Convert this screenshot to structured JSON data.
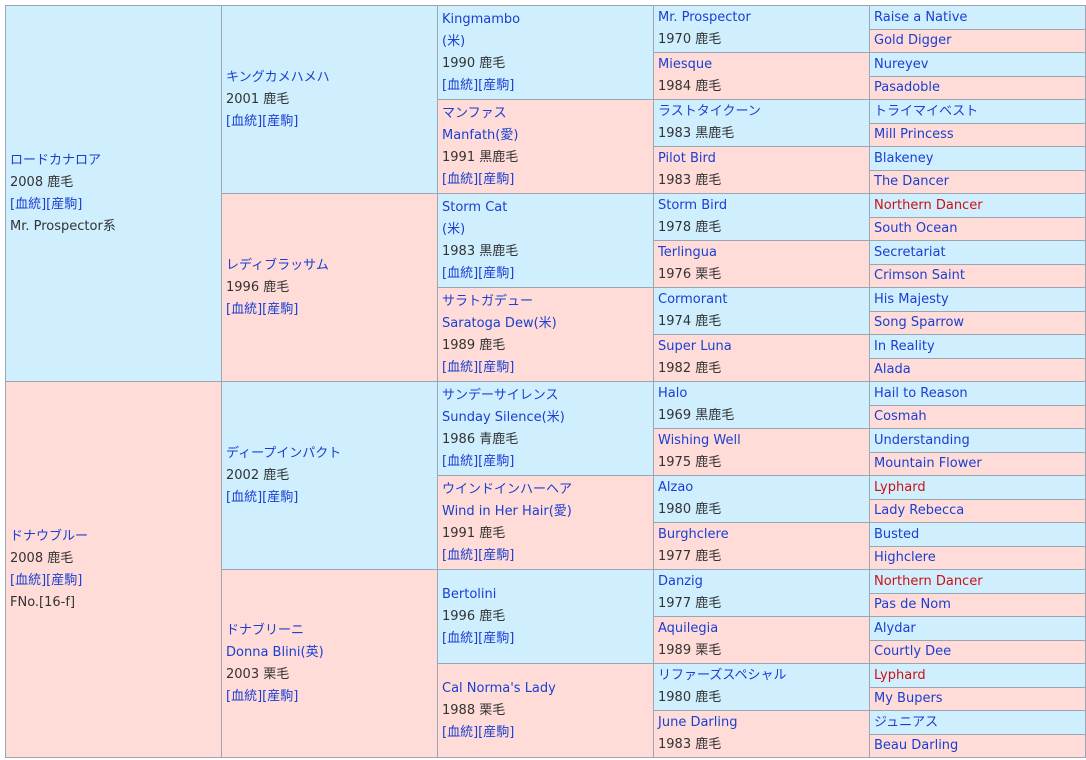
{
  "link_color": "#1a3fd1",
  "highlight_color": "#d01010",
  "male_bg": "#cfefff",
  "female_bg": "#ffdcd8",
  "cells": [
    {
      "id": "g0-0",
      "gen": 0,
      "row": 0,
      "span": 16,
      "sex": "m",
      "lines": [
        {
          "t": "ロードカナロア",
          "link": true
        },
        {
          "t": "2008 鹿毛"
        },
        {
          "t": "[血統][産駒]",
          "link": true
        },
        {
          "t": "Mr. Prospector系"
        }
      ]
    },
    {
      "id": "g0-1",
      "gen": 0,
      "row": 16,
      "span": 16,
      "sex": "f",
      "lines": [
        {
          "t": "ドナウブルー",
          "link": true
        },
        {
          "t": "2008 鹿毛"
        },
        {
          "t": "[血統][産駒]",
          "link": true
        },
        {
          "t": "FNo.[16-f]"
        }
      ]
    },
    {
      "id": "g1-0",
      "gen": 1,
      "row": 0,
      "span": 8,
      "sex": "m",
      "lines": [
        {
          "t": "キングカメハメハ",
          "link": true
        },
        {
          "t": "2001 鹿毛"
        },
        {
          "t": "[血統][産駒]",
          "link": true
        }
      ]
    },
    {
      "id": "g1-1",
      "gen": 1,
      "row": 8,
      "span": 8,
      "sex": "f",
      "lines": [
        {
          "t": "レディブラッサム",
          "link": true
        },
        {
          "t": "1996 鹿毛"
        },
        {
          "t": "[血統][産駒]",
          "link": true
        }
      ]
    },
    {
      "id": "g1-2",
      "gen": 1,
      "row": 16,
      "span": 8,
      "sex": "m",
      "lines": [
        {
          "t": "ディープインパクト",
          "link": true
        },
        {
          "t": "2002 鹿毛"
        },
        {
          "t": "[血統][産駒]",
          "link": true
        }
      ]
    },
    {
      "id": "g1-3",
      "gen": 1,
      "row": 24,
      "span": 8,
      "sex": "f",
      "lines": [
        {
          "t": "ドナブリーニ",
          "link": true
        },
        {
          "t": "Donna Blini(英)",
          "link": true
        },
        {
          "t": "2003 栗毛"
        },
        {
          "t": "[血統][産駒]",
          "link": true
        }
      ]
    },
    {
      "id": "g2-0",
      "gen": 2,
      "row": 0,
      "span": 4,
      "sex": "m",
      "lines": [
        {
          "t": "Kingmambo",
          "link": true
        },
        {
          "t": "(米)",
          "link": true
        },
        {
          "t": "1990 鹿毛"
        },
        {
          "t": "[血統][産駒]",
          "link": true
        }
      ]
    },
    {
      "id": "g2-1",
      "gen": 2,
      "row": 4,
      "span": 4,
      "sex": "f",
      "lines": [
        {
          "t": "マンファス",
          "link": true
        },
        {
          "t": "Manfath(愛)",
          "link": true
        },
        {
          "t": "1991 黒鹿毛"
        },
        {
          "t": "[血統][産駒]",
          "link": true
        }
      ]
    },
    {
      "id": "g2-2",
      "gen": 2,
      "row": 8,
      "span": 4,
      "sex": "m",
      "lines": [
        {
          "t": "Storm Cat",
          "link": true
        },
        {
          "t": "(米)",
          "link": true
        },
        {
          "t": "1983 黒鹿毛"
        },
        {
          "t": "[血統][産駒]",
          "link": true
        }
      ]
    },
    {
      "id": "g2-3",
      "gen": 2,
      "row": 12,
      "span": 4,
      "sex": "f",
      "lines": [
        {
          "t": "サラトガデュー",
          "link": true
        },
        {
          "t": "Saratoga Dew(米)",
          "link": true
        },
        {
          "t": "1989 鹿毛"
        },
        {
          "t": "[血統][産駒]",
          "link": true
        }
      ]
    },
    {
      "id": "g2-4",
      "gen": 2,
      "row": 16,
      "span": 4,
      "sex": "m",
      "lines": [
        {
          "t": "サンデーサイレンス",
          "link": true
        },
        {
          "t": "Sunday Silence(米)",
          "link": true
        },
        {
          "t": "1986 青鹿毛"
        },
        {
          "t": "[血統][産駒]",
          "link": true
        }
      ]
    },
    {
      "id": "g2-5",
      "gen": 2,
      "row": 20,
      "span": 4,
      "sex": "f",
      "lines": [
        {
          "t": "ウインドインハーヘア",
          "link": true
        },
        {
          "t": "Wind in Her Hair(愛)",
          "link": true
        },
        {
          "t": "1991 鹿毛"
        },
        {
          "t": "[血統][産駒]",
          "link": true
        }
      ]
    },
    {
      "id": "g2-6",
      "gen": 2,
      "row": 24,
      "span": 4,
      "sex": "m",
      "lines": [
        {
          "t": "Bertolini",
          "link": true
        },
        {
          "t": "1996 鹿毛"
        },
        {
          "t": "[血統][産駒]",
          "link": true
        }
      ]
    },
    {
      "id": "g2-7",
      "gen": 2,
      "row": 28,
      "span": 4,
      "sex": "f",
      "lines": [
        {
          "t": "Cal Norma's Lady",
          "link": true
        },
        {
          "t": "1988 栗毛"
        },
        {
          "t": "[血統][産駒]",
          "link": true
        }
      ]
    },
    {
      "id": "g3-0",
      "gen": 3,
      "row": 0,
      "span": 2,
      "sex": "m",
      "lines": [
        {
          "t": "Mr. Prospector",
          "link": true
        },
        {
          "t": "1970 鹿毛"
        }
      ]
    },
    {
      "id": "g3-1",
      "gen": 3,
      "row": 2,
      "span": 2,
      "sex": "f",
      "lines": [
        {
          "t": "Miesque",
          "link": true
        },
        {
          "t": "1984 鹿毛"
        }
      ]
    },
    {
      "id": "g3-2",
      "gen": 3,
      "row": 4,
      "span": 2,
      "sex": "m",
      "lines": [
        {
          "t": "ラストタイクーン",
          "link": true
        },
        {
          "t": "1983 黒鹿毛"
        }
      ]
    },
    {
      "id": "g3-3",
      "gen": 3,
      "row": 6,
      "span": 2,
      "sex": "f",
      "lines": [
        {
          "t": "Pilot Bird",
          "link": true
        },
        {
          "t": "1983 鹿毛"
        }
      ]
    },
    {
      "id": "g3-4",
      "gen": 3,
      "row": 8,
      "span": 2,
      "sex": "m",
      "lines": [
        {
          "t": "Storm Bird",
          "link": true
        },
        {
          "t": "1978 鹿毛"
        }
      ]
    },
    {
      "id": "g3-5",
      "gen": 3,
      "row": 10,
      "span": 2,
      "sex": "f",
      "lines": [
        {
          "t": "Terlingua",
          "link": true
        },
        {
          "t": "1976 栗毛"
        }
      ]
    },
    {
      "id": "g3-6",
      "gen": 3,
      "row": 12,
      "span": 2,
      "sex": "m",
      "lines": [
        {
          "t": "Cormorant",
          "link": true
        },
        {
          "t": "1974 鹿毛"
        }
      ]
    },
    {
      "id": "g3-7",
      "gen": 3,
      "row": 14,
      "span": 2,
      "sex": "f",
      "lines": [
        {
          "t": "Super Luna",
          "link": true
        },
        {
          "t": "1982 鹿毛"
        }
      ]
    },
    {
      "id": "g3-8",
      "gen": 3,
      "row": 16,
      "span": 2,
      "sex": "m",
      "lines": [
        {
          "t": "Halo",
          "link": true
        },
        {
          "t": "1969 黒鹿毛"
        }
      ]
    },
    {
      "id": "g3-9",
      "gen": 3,
      "row": 18,
      "span": 2,
      "sex": "f",
      "lines": [
        {
          "t": "Wishing Well",
          "link": true
        },
        {
          "t": "1975 鹿毛"
        }
      ]
    },
    {
      "id": "g3-10",
      "gen": 3,
      "row": 20,
      "span": 2,
      "sex": "m",
      "lines": [
        {
          "t": "Alzao",
          "link": true
        },
        {
          "t": "1980 鹿毛"
        }
      ]
    },
    {
      "id": "g3-11",
      "gen": 3,
      "row": 22,
      "span": 2,
      "sex": "f",
      "lines": [
        {
          "t": "Burghclere",
          "link": true
        },
        {
          "t": "1977 鹿毛"
        }
      ]
    },
    {
      "id": "g3-12",
      "gen": 3,
      "row": 24,
      "span": 2,
      "sex": "m",
      "lines": [
        {
          "t": "Danzig",
          "link": true
        },
        {
          "t": "1977 鹿毛"
        }
      ]
    },
    {
      "id": "g3-13",
      "gen": 3,
      "row": 26,
      "span": 2,
      "sex": "f",
      "lines": [
        {
          "t": "Aquilegia",
          "link": true
        },
        {
          "t": "1989 栗毛"
        }
      ]
    },
    {
      "id": "g3-14",
      "gen": 3,
      "row": 28,
      "span": 2,
      "sex": "m",
      "lines": [
        {
          "t": "リファーズスペシャル",
          "link": true
        },
        {
          "t": "1980 鹿毛"
        }
      ]
    },
    {
      "id": "g3-15",
      "gen": 3,
      "row": 30,
      "span": 2,
      "sex": "f",
      "lines": [
        {
          "t": "June Darling",
          "link": true
        },
        {
          "t": "1983 鹿毛"
        }
      ]
    },
    {
      "id": "g4-0",
      "gen": 4,
      "row": 0,
      "span": 1,
      "sex": "m",
      "lines": [
        {
          "t": "Raise a Native",
          "link": true
        }
      ]
    },
    {
      "id": "g4-1",
      "gen": 4,
      "row": 1,
      "span": 1,
      "sex": "f",
      "lines": [
        {
          "t": "Gold Digger",
          "link": true
        }
      ]
    },
    {
      "id": "g4-2",
      "gen": 4,
      "row": 2,
      "span": 1,
      "sex": "m",
      "lines": [
        {
          "t": "Nureyev",
          "link": true
        }
      ]
    },
    {
      "id": "g4-3",
      "gen": 4,
      "row": 3,
      "span": 1,
      "sex": "f",
      "lines": [
        {
          "t": "Pasadoble",
          "link": true
        }
      ]
    },
    {
      "id": "g4-4",
      "gen": 4,
      "row": 4,
      "span": 1,
      "sex": "m",
      "lines": [
        {
          "t": "トライマイベスト",
          "link": true
        }
      ]
    },
    {
      "id": "g4-5",
      "gen": 4,
      "row": 5,
      "span": 1,
      "sex": "f",
      "lines": [
        {
          "t": "Mill Princess",
          "link": true
        }
      ]
    },
    {
      "id": "g4-6",
      "gen": 4,
      "row": 6,
      "span": 1,
      "sex": "m",
      "lines": [
        {
          "t": "Blakeney",
          "link": true
        }
      ]
    },
    {
      "id": "g4-7",
      "gen": 4,
      "row": 7,
      "span": 1,
      "sex": "f",
      "lines": [
        {
          "t": "The Dancer",
          "link": true
        }
      ]
    },
    {
      "id": "g4-8",
      "gen": 4,
      "row": 8,
      "span": 1,
      "sex": "m",
      "lines": [
        {
          "t": "Northern Dancer",
          "link": true,
          "red": true
        }
      ]
    },
    {
      "id": "g4-9",
      "gen": 4,
      "row": 9,
      "span": 1,
      "sex": "f",
      "lines": [
        {
          "t": "South Ocean",
          "link": true
        }
      ]
    },
    {
      "id": "g4-10",
      "gen": 4,
      "row": 10,
      "span": 1,
      "sex": "m",
      "lines": [
        {
          "t": "Secretariat",
          "link": true
        }
      ]
    },
    {
      "id": "g4-11",
      "gen": 4,
      "row": 11,
      "span": 1,
      "sex": "f",
      "lines": [
        {
          "t": "Crimson Saint",
          "link": true
        }
      ]
    },
    {
      "id": "g4-12",
      "gen": 4,
      "row": 12,
      "span": 1,
      "sex": "m",
      "lines": [
        {
          "t": "His Majesty",
          "link": true
        }
      ]
    },
    {
      "id": "g4-13",
      "gen": 4,
      "row": 13,
      "span": 1,
      "sex": "f",
      "lines": [
        {
          "t": "Song Sparrow",
          "link": true
        }
      ]
    },
    {
      "id": "g4-14",
      "gen": 4,
      "row": 14,
      "span": 1,
      "sex": "m",
      "lines": [
        {
          "t": "In Reality",
          "link": true
        }
      ]
    },
    {
      "id": "g4-15",
      "gen": 4,
      "row": 15,
      "span": 1,
      "sex": "f",
      "lines": [
        {
          "t": "Alada",
          "link": true
        }
      ]
    },
    {
      "id": "g4-16",
      "gen": 4,
      "row": 16,
      "span": 1,
      "sex": "m",
      "lines": [
        {
          "t": "Hail to Reason",
          "link": true
        }
      ]
    },
    {
      "id": "g4-17",
      "gen": 4,
      "row": 17,
      "span": 1,
      "sex": "f",
      "lines": [
        {
          "t": "Cosmah",
          "link": true
        }
      ]
    },
    {
      "id": "g4-18",
      "gen": 4,
      "row": 18,
      "span": 1,
      "sex": "m",
      "lines": [
        {
          "t": "Understanding",
          "link": true
        }
      ]
    },
    {
      "id": "g4-19",
      "gen": 4,
      "row": 19,
      "span": 1,
      "sex": "f",
      "lines": [
        {
          "t": "Mountain Flower",
          "link": true
        }
      ]
    },
    {
      "id": "g4-20",
      "gen": 4,
      "row": 20,
      "span": 1,
      "sex": "m",
      "lines": [
        {
          "t": "Lyphard",
          "link": true,
          "red": true
        }
      ]
    },
    {
      "id": "g4-21",
      "gen": 4,
      "row": 21,
      "span": 1,
      "sex": "f",
      "lines": [
        {
          "t": "Lady Rebecca",
          "link": true
        }
      ]
    },
    {
      "id": "g4-22",
      "gen": 4,
      "row": 22,
      "span": 1,
      "sex": "m",
      "lines": [
        {
          "t": "Busted",
          "link": true
        }
      ]
    },
    {
      "id": "g4-23",
      "gen": 4,
      "row": 23,
      "span": 1,
      "sex": "f",
      "lines": [
        {
          "t": "Highclere",
          "link": true
        }
      ]
    },
    {
      "id": "g4-24",
      "gen": 4,
      "row": 24,
      "span": 1,
      "sex": "m",
      "lines": [
        {
          "t": "Northern Dancer",
          "link": true,
          "red": true
        }
      ]
    },
    {
      "id": "g4-25",
      "gen": 4,
      "row": 25,
      "span": 1,
      "sex": "f",
      "lines": [
        {
          "t": "Pas de Nom",
          "link": true
        }
      ]
    },
    {
      "id": "g4-26",
      "gen": 4,
      "row": 26,
      "span": 1,
      "sex": "m",
      "lines": [
        {
          "t": "Alydar",
          "link": true
        }
      ]
    },
    {
      "id": "g4-27",
      "gen": 4,
      "row": 27,
      "span": 1,
      "sex": "f",
      "lines": [
        {
          "t": "Courtly Dee",
          "link": true
        }
      ]
    },
    {
      "id": "g4-28",
      "gen": 4,
      "row": 28,
      "span": 1,
      "sex": "m",
      "lines": [
        {
          "t": "Lyphard",
          "link": true,
          "red": true
        }
      ]
    },
    {
      "id": "g4-29",
      "gen": 4,
      "row": 29,
      "span": 1,
      "sex": "f",
      "lines": [
        {
          "t": "My Bupers",
          "link": true
        }
      ]
    },
    {
      "id": "g4-30",
      "gen": 4,
      "row": 30,
      "span": 1,
      "sex": "m",
      "lines": [
        {
          "t": "ジュニアス",
          "link": true
        }
      ]
    },
    {
      "id": "g4-31",
      "gen": 4,
      "row": 31,
      "span": 1,
      "sex": "f",
      "lines": [
        {
          "t": "Beau Darling",
          "link": true
        }
      ]
    }
  ]
}
